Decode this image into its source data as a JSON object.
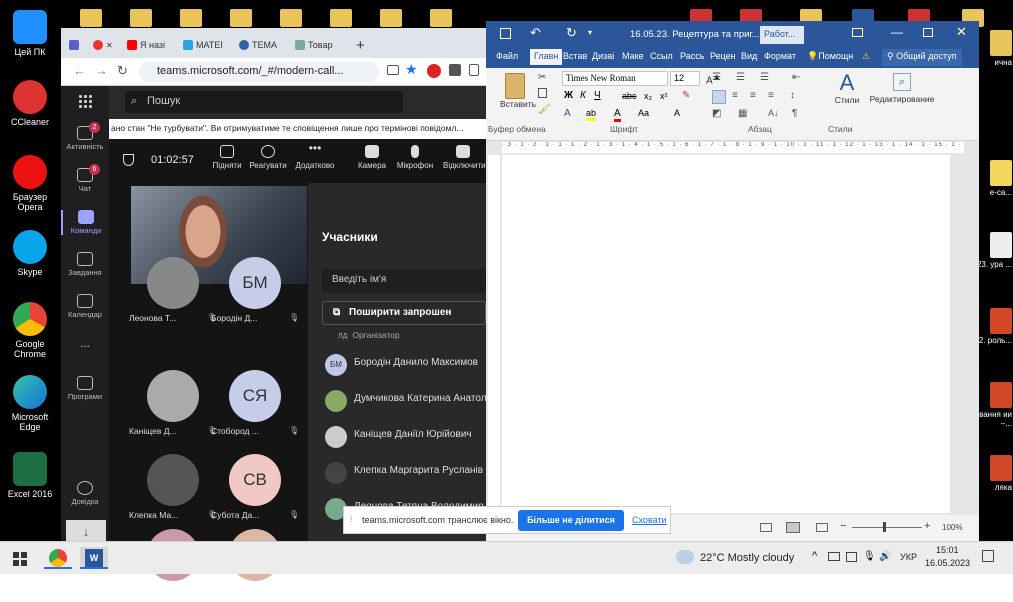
{
  "desktop": {
    "left_icons": [
      {
        "label": "Цей ПК",
        "icon": "computer-icon",
        "color": "#1e90ff"
      },
      {
        "label": "CCleaner",
        "icon": "ccleaner-icon",
        "color": "#d33"
      },
      {
        "label": "Браузер Opera",
        "icon": "opera-icon",
        "color": "#e11"
      },
      {
        "label": "Skype",
        "icon": "skype-icon",
        "color": "#0aa5e8"
      },
      {
        "label": "Google Chrome",
        "icon": "chrome-icon",
        "color": "#34a853"
      },
      {
        "label": "Microsoft Edge",
        "icon": "edge-icon",
        "color": "#1a8fd8"
      },
      {
        "label": "Excel 2016",
        "icon": "excel-icon",
        "color": "#1d6f42"
      }
    ],
    "right_icons": [
      {
        "label": "ична",
        "icon": "folder-icon"
      },
      {
        "label": "е-са...",
        "icon": "document-icon"
      },
      {
        "label": "23. ура ...",
        "icon": "document-icon"
      },
      {
        "label": "22. роль...",
        "icon": "powerpoint-icon"
      },
      {
        "label": "вання ии –...",
        "icon": "powerpoint-icon"
      },
      {
        "label": "ляка",
        "icon": "powerpoint-icon"
      }
    ]
  },
  "chrome": {
    "tabs": [
      {
        "label": "",
        "icon": "teams-tab-icon"
      },
      {
        "label": "",
        "icon": "record-icon"
      },
      {
        "label": "Я назі",
        "icon": "youtube-icon"
      },
      {
        "label": "MATEI",
        "icon": "snowflake-icon"
      },
      {
        "label": "ТЕМА",
        "icon": "web-icon"
      },
      {
        "label": "Товар",
        "icon": "product-icon"
      }
    ],
    "new_tab": "+",
    "url": "teams.microsoft.com/_#/modern-call..."
  },
  "teams": {
    "rail": [
      {
        "label": "Активність",
        "badge": "2"
      },
      {
        "label": "Чат",
        "badge": "6"
      },
      {
        "label": "Команди",
        "badge": ""
      },
      {
        "label": "Завдання",
        "badge": ""
      },
      {
        "label": "Календар",
        "badge": ""
      },
      {
        "label": "...",
        "badge": ""
      },
      {
        "label": "Програми",
        "badge": ""
      },
      {
        "label": "Довідка",
        "badge": ""
      }
    ],
    "search_placeholder": "Пошук",
    "banner": "ано стан \"Не турбувати\". Ви отримуватиме те сповіщення лише про термінові повідомл...",
    "timer": "01:02:57",
    "call_buttons": [
      "Підняти",
      "Реагувати",
      "Додатково",
      "Камера",
      "Мікрофон",
      "Відключити"
    ],
    "tiles": [
      {
        "name": "Леонова Т...",
        "initials": "",
        "color": "#888"
      },
      {
        "name": "Бородін Д...",
        "initials": "БМ",
        "color": "#c6cde8"
      },
      {
        "name": "Каніщев Д...",
        "initials": "",
        "color": "#aaa"
      },
      {
        "name": "Стобород ...",
        "initials": "СЯ",
        "color": "#c6cde8"
      },
      {
        "name": "Клепка Ма...",
        "initials": "",
        "color": "#555"
      },
      {
        "name": "Субота Да...",
        "initials": "СВ",
        "color": "#f2c8c4"
      }
    ],
    "people_title": "Учасники",
    "invite_placeholder": "Введіть ім'я",
    "share_invite": "Поширити запрошен",
    "organizer_label": "Організатор",
    "participants": [
      {
        "initials": "БМ",
        "name": "Бородін Данило Максимов"
      },
      {
        "initials": "",
        "name": "Думчикова Катерина Анатол"
      },
      {
        "initials": "",
        "name": "Каніщев Даніїл Юрійович"
      },
      {
        "initials": "",
        "name": "Клепка Маргарита Русланів"
      },
      {
        "initials": "",
        "name": "Леонова Тетяна Володимир"
      }
    ]
  },
  "word": {
    "title": "16.05.23. Рецептура та приг...",
    "status_word": "Работ...",
    "tabs": [
      "Файл",
      "Главн",
      "Встав",
      "Дизаі",
      "Маке",
      "Ссыл",
      "Рассь",
      "Рецен",
      "Вид",
      "Формат"
    ],
    "help": "Помощн",
    "share": "Общий доступ",
    "font_name": "Times New Roman",
    "font_size": "12",
    "groups": [
      "Буфер обмена",
      "Шрифт",
      "Абзац",
      "Стили"
    ],
    "paste_label": "Вставить",
    "styles_label": "Стили",
    "editing_label": "Редактирование",
    "zoom": "100%"
  },
  "share_bar": {
    "message": "teams.microsoft.com транслює вікно.",
    "stop": "Більше не ділитися",
    "hide": "Сховати"
  },
  "taskbar": {
    "weather": "22°C  Mostly cloudy",
    "language": "УКР",
    "time": "15:01",
    "date": "16.05.2023"
  }
}
